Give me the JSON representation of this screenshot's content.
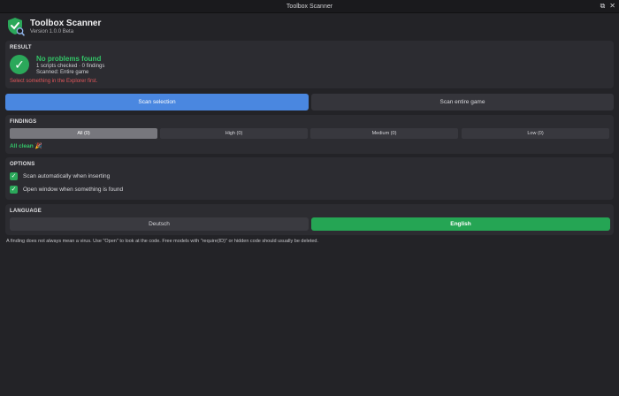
{
  "window": {
    "title": "Toolbox Scanner",
    "buttons": [
      "⧉",
      "✕"
    ]
  },
  "header": {
    "app_name": "Toolbox Scanner",
    "version": "Version 1.0.0 Beta"
  },
  "result": {
    "section_title": "RESULT",
    "status_title": "No problems found",
    "line1": "1 scripts checked · 0 findings",
    "line2": "Scanned: Entire game",
    "warning": "Select something in the Explorer first.",
    "status_icon": "checkmark-icon",
    "colors": {
      "ok": "#2ba85a",
      "warning": "#e0575b"
    }
  },
  "scan": {
    "selection_label": "Scan selection",
    "entire_label": "Scan entire game",
    "accent": "#4a87e0"
  },
  "findings": {
    "section_title": "FINDINGS",
    "tabs": [
      {
        "label": "All (0)",
        "active": true
      },
      {
        "label": "High (0)",
        "active": false
      },
      {
        "label": "Medium (0)",
        "active": false
      },
      {
        "label": "Low (0)",
        "active": false
      }
    ],
    "status": "All clean 🎉"
  },
  "options": {
    "section_title": "OPTIONS",
    "items": [
      {
        "label": "Scan automatically when inserting",
        "checked": true
      },
      {
        "label": "Open window when something is found",
        "checked": true
      }
    ]
  },
  "language": {
    "section_title": "LANGUAGE",
    "options": [
      {
        "label": "Deutsch",
        "selected": false
      },
      {
        "label": "English",
        "selected": true
      }
    ]
  },
  "footer": {
    "note": "A finding does not always mean a virus. Use \"Open\" to look at the code. Free models with \"require(ID)\" or hidden code should usually be deleted."
  }
}
